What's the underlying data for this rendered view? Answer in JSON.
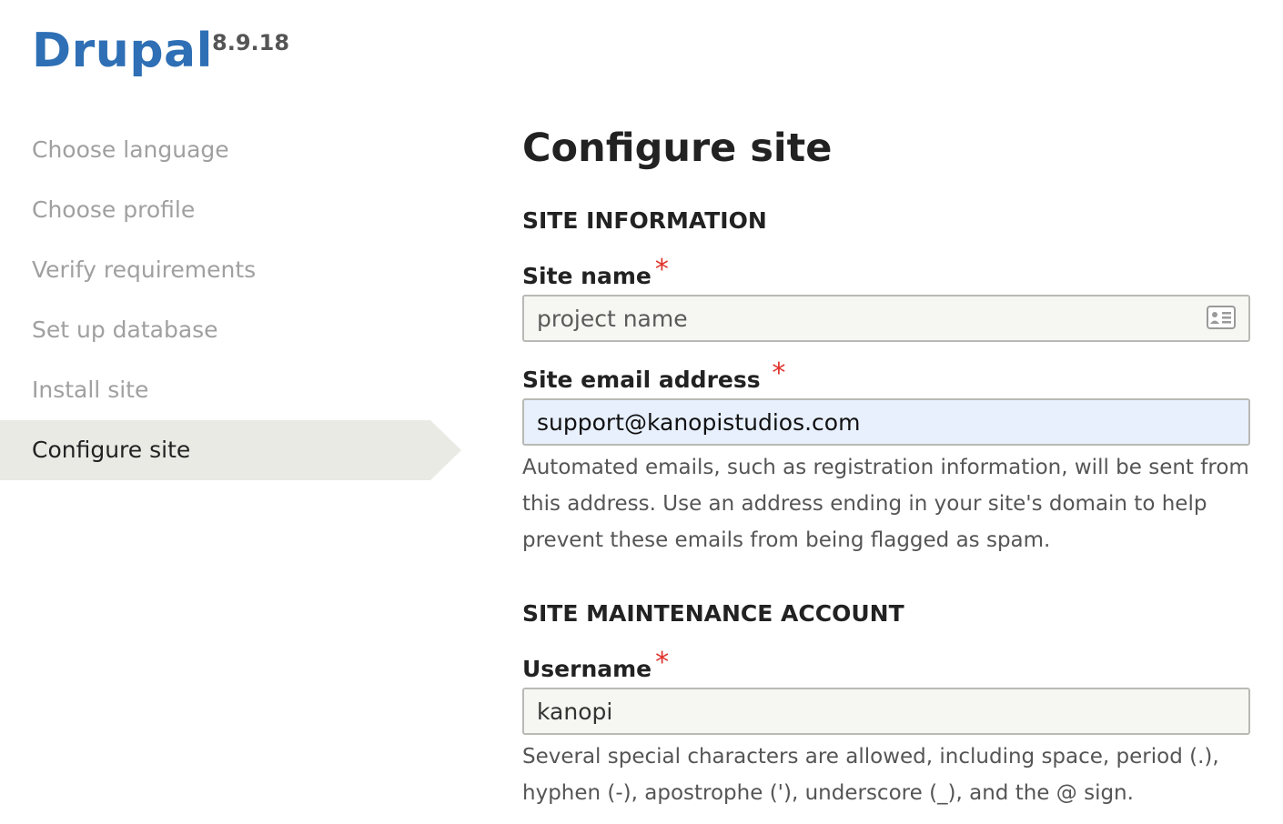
{
  "brand": {
    "name": "Drupal",
    "version": "8.9.18"
  },
  "tasks": [
    {
      "label": "Choose language",
      "state": "done"
    },
    {
      "label": "Choose profile",
      "state": "done"
    },
    {
      "label": "Verify requirements",
      "state": "done"
    },
    {
      "label": "Set up database",
      "state": "done"
    },
    {
      "label": "Install site",
      "state": "done"
    },
    {
      "label": "Configure site",
      "state": "active"
    }
  ],
  "main": {
    "title": "Configure site",
    "site_information": {
      "heading": "SITE INFORMATION",
      "site_name": {
        "label": "Site name",
        "required_marker": "*",
        "value": "",
        "placeholder": "project name",
        "icon": "contact-card-icon"
      },
      "site_email": {
        "label": "Site email address",
        "required_marker": "*",
        "value": "support@kanopistudios.com",
        "description": "Automated emails, such as registration information, will be sent from this address. Use an address ending in your site's domain to help prevent these emails from being flagged as spam."
      }
    },
    "maintenance_account": {
      "heading": "SITE MAINTENANCE ACCOUNT",
      "username": {
        "label": "Username",
        "required_marker": "*",
        "value": "kanopi",
        "description": "Several special characters are allowed, including space, period (.), hyphen (-), apostrophe ('), underscore (_), and the @ sign."
      }
    }
  },
  "colors": {
    "brand": "#2e6fb5",
    "required": "#e0302a",
    "active_task_bg": "#eaeae5",
    "autofill_bg": "#e8f0fe"
  }
}
